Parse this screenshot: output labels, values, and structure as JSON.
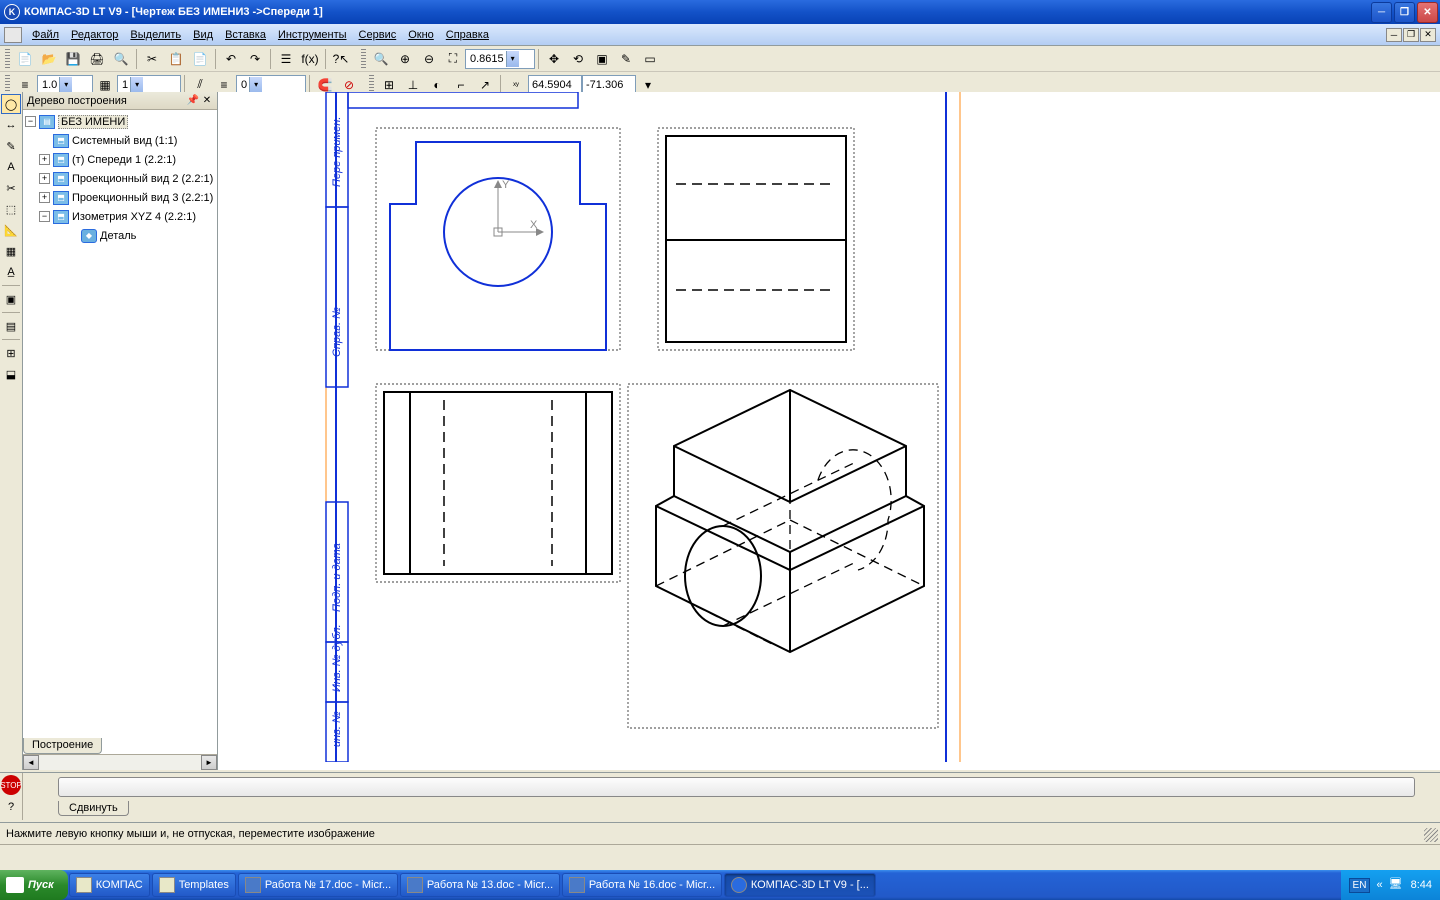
{
  "titlebar": {
    "app_icon_letter": "K",
    "title": "КОМПАС-3D LT V9 - [Чертеж БЕЗ ИМЕНИ3 ->Спереди 1]"
  },
  "menu": {
    "items": [
      "Файл",
      "Редактор",
      "Выделить",
      "Вид",
      "Вставка",
      "Инструменты",
      "Сервис",
      "Окно",
      "Справка"
    ]
  },
  "toolbar2": {
    "line_width": "1.0",
    "layer_num": "1",
    "style_num": "0",
    "zoom": "0.8615",
    "coord_x": "64.5904",
    "coord_y": "-71.306"
  },
  "tree": {
    "title": "Дерево построения",
    "root": "БЕЗ ИМЕНИ",
    "items": [
      {
        "label": "Системный вид (1:1)",
        "expandable": false
      },
      {
        "label": "(т) Спереди 1 (2.2:1)",
        "expandable": true
      },
      {
        "label": "Проекционный вид 2 (2.2:1)",
        "expandable": true
      },
      {
        "label": "Проекционный вид 3 (2.2:1)",
        "expandable": true
      },
      {
        "label": "Изометрия XYZ 4 (2.2:1)",
        "expandable": true
      }
    ],
    "detail": "Деталь"
  },
  "doc_tab": "Построение",
  "cmd_tab": "Сдвинуть",
  "status": {
    "hint": "Нажмите левую кнопку мыши и, не отпуская, переместите изображение"
  },
  "taskbar": {
    "start": "Пуск",
    "items": [
      {
        "label": "КОМПАС",
        "active": false
      },
      {
        "label": "Templates",
        "active": false
      },
      {
        "label": "Работа № 17.doc - Micr...",
        "active": false
      },
      {
        "label": "Работа № 13.doc - Micr...",
        "active": false
      },
      {
        "label": "Работа № 16.doc - Micr...",
        "active": false
      },
      {
        "label": "КОМПАС-3D LT V9 - [...",
        "active": true
      }
    ],
    "lang": "EN",
    "time": "8:44"
  },
  "drawing": {
    "axis_y": "Y",
    "axis_x": "X",
    "labels": {
      "perv": "Пере примен.",
      "sprv": "Справ. №",
      "podp": "Подп. и дата",
      "inv_d": "Инв. № дубл.",
      "inv": "инв. №"
    }
  }
}
